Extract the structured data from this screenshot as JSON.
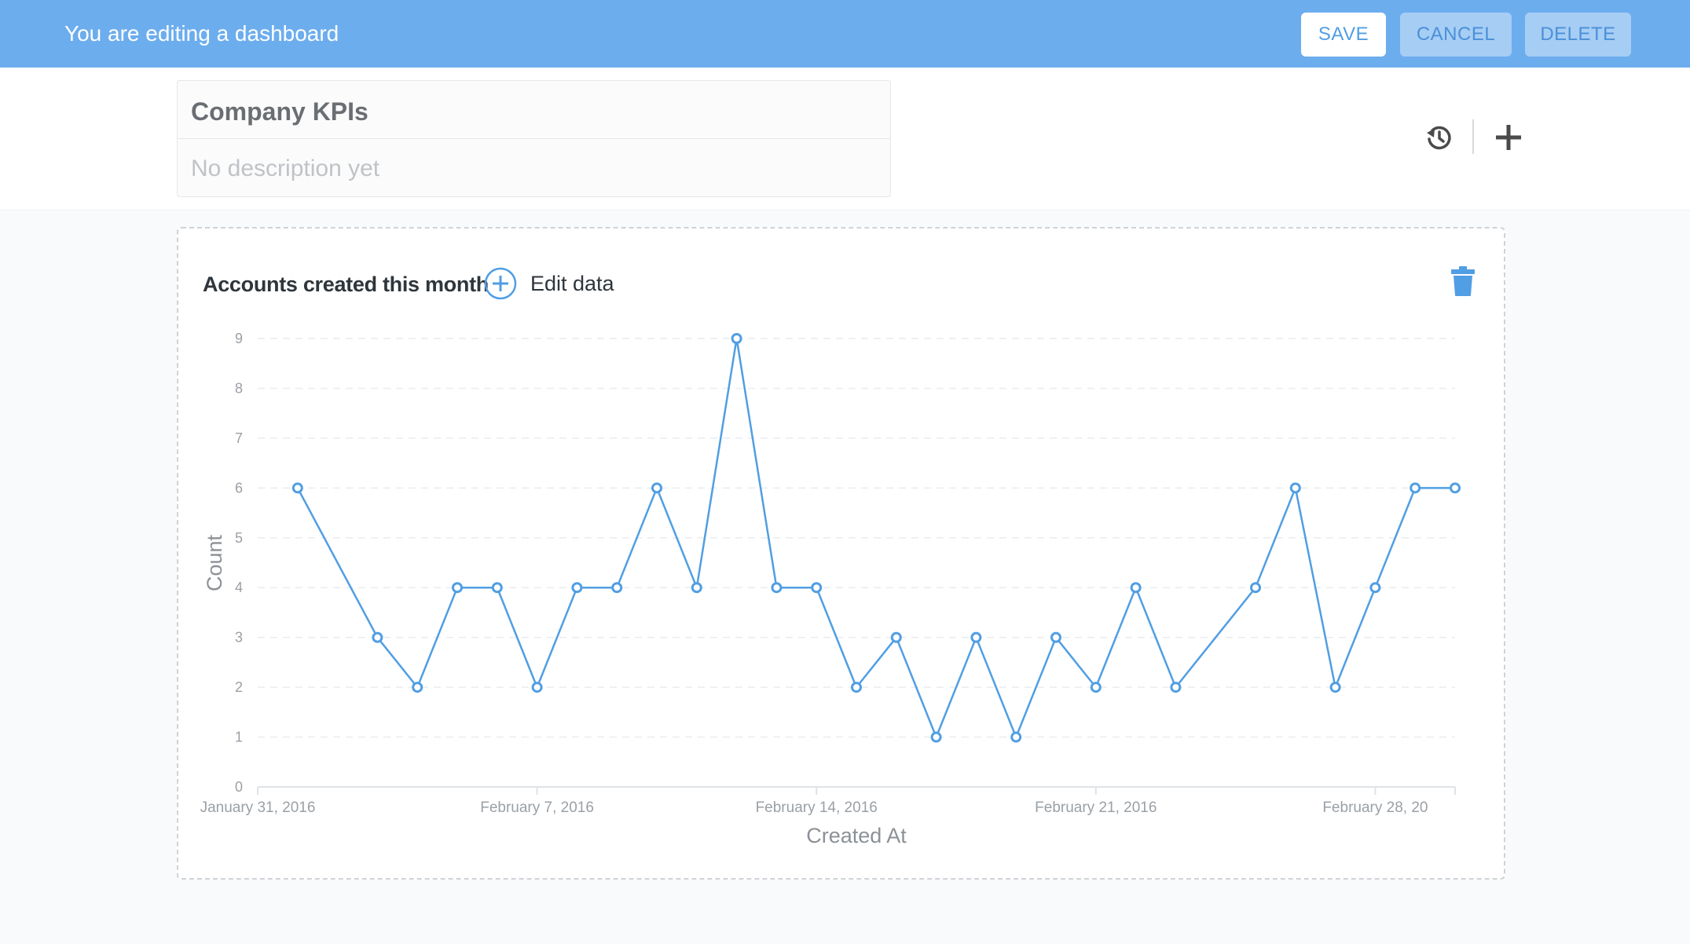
{
  "edit_bar": {
    "title": "You are editing a dashboard",
    "save_label": "SAVE",
    "cancel_label": "CANCEL",
    "delete_label": "DELETE"
  },
  "dashboard": {
    "name": "Company KPIs",
    "description_placeholder": "No description yet",
    "icons": [
      "history-icon",
      "add-icon"
    ]
  },
  "card": {
    "title": "Accounts created this month",
    "edit_label": "Edit data",
    "icons": [
      "plus-circle-icon",
      "trash-icon"
    ]
  },
  "colors": {
    "accent": "#509EE3",
    "edit_bar": "#6CADEE",
    "button_muted": "#A6CDF4"
  },
  "chart_data": {
    "type": "line",
    "xlabel": "Created At",
    "ylabel": "Count",
    "ylim": [
      0,
      9
    ],
    "y_ticks": [
      "0",
      "1",
      "2",
      "3",
      "4",
      "5",
      "6",
      "7",
      "8",
      "9"
    ],
    "x_tick_labels": [
      "January 31, 2016",
      "February 7, 2016",
      "February 14, 2016",
      "February 21, 2016",
      "February 28, 20"
    ],
    "grid": true,
    "x": [
      "2016-02-01",
      "2016-02-03",
      "2016-02-04",
      "2016-02-05",
      "2016-02-06",
      "2016-02-07",
      "2016-02-08",
      "2016-02-09",
      "2016-02-10",
      "2016-02-11",
      "2016-02-12",
      "2016-02-13",
      "2016-02-14",
      "2016-02-15",
      "2016-02-16",
      "2016-02-17",
      "2016-02-18",
      "2016-02-19",
      "2016-02-20",
      "2016-02-21",
      "2016-02-22",
      "2016-02-23",
      "2016-02-25",
      "2016-02-26",
      "2016-02-27",
      "2016-02-28",
      "2016-02-29",
      "2016-03-01"
    ],
    "series": [
      {
        "values": [
          6,
          3,
          2,
          4,
          4,
          2,
          4,
          4,
          6,
          4,
          9,
          4,
          4,
          2,
          3,
          1,
          3,
          1,
          3,
          2,
          4,
          2,
          4,
          6,
          2,
          4,
          6,
          6
        ]
      }
    ]
  }
}
